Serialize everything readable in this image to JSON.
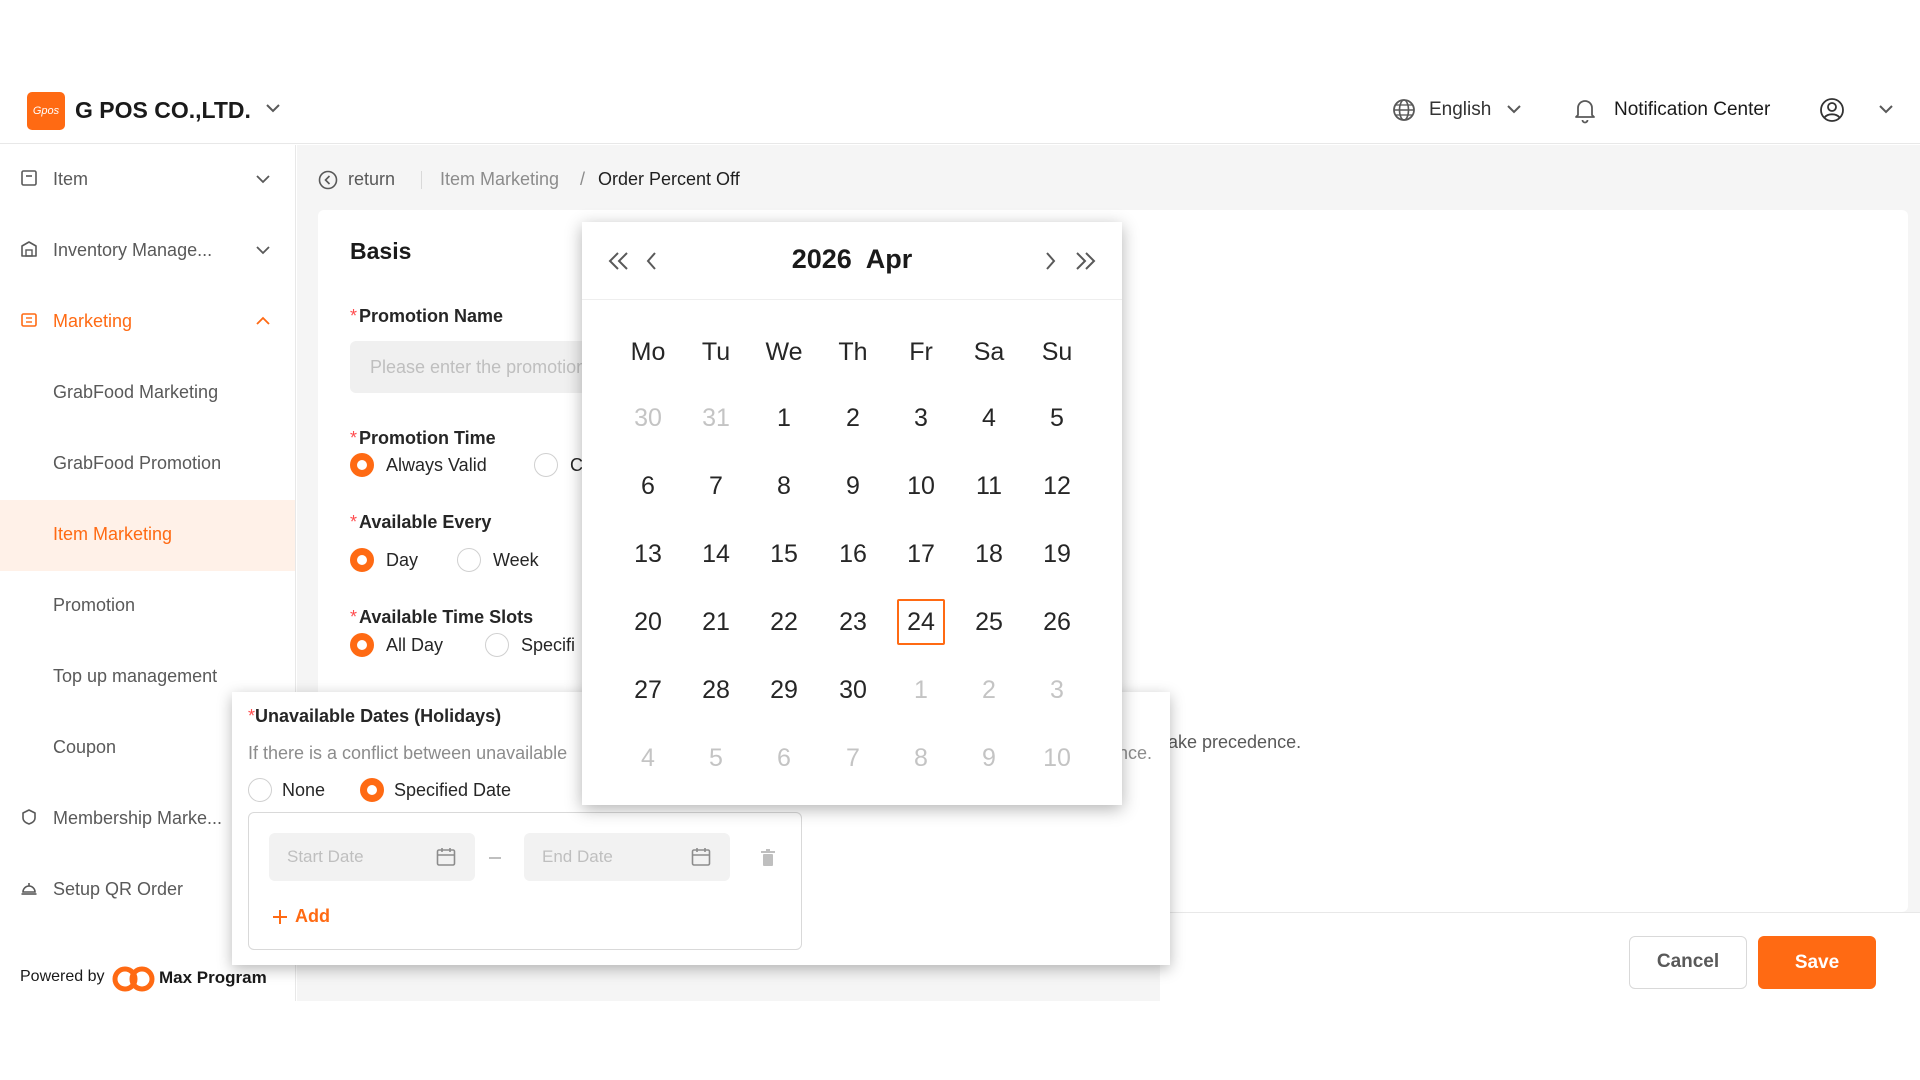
{
  "header": {
    "logo_text": "Gpos",
    "company": "G POS CO.,LTD.",
    "language": "English",
    "notification": "Notification Center"
  },
  "sidebar": {
    "items": [
      {
        "label": "Item",
        "icon": "box-icon"
      },
      {
        "label": "Inventory Manage...",
        "icon": "warehouse-icon"
      },
      {
        "label": "Marketing",
        "icon": "ticket-icon"
      },
      {
        "label": "GrabFood Marketing"
      },
      {
        "label": "GrabFood Promotion"
      },
      {
        "label": "Item Marketing"
      },
      {
        "label": "Promotion"
      },
      {
        "label": "Top up management"
      },
      {
        "label": "Coupon"
      },
      {
        "label": "Membership Marke...",
        "icon": "badge-icon"
      },
      {
        "label": "Setup QR Order",
        "icon": "service-bell-icon"
      }
    ],
    "powered_by": "Powered by",
    "brand": "Max Program"
  },
  "breadcrumb": {
    "return": "return",
    "parent": "Item Marketing",
    "separator": "/",
    "current": "Order Percent Off"
  },
  "form": {
    "section": "Basis",
    "required_mark": "*",
    "promotion_name": {
      "label": "Promotion Name",
      "placeholder": "Please enter the promotion name"
    },
    "promotion_time": {
      "label": "Promotion Time",
      "options": [
        "Always Valid",
        "C"
      ],
      "selected": "Always Valid"
    },
    "available_every": {
      "label": "Available Every",
      "options": [
        "Day",
        "Week"
      ],
      "selected": "Day"
    },
    "time_slots": {
      "label": "Available Time Slots",
      "options": [
        "All Day",
        "Specifi"
      ],
      "selected": "All Day"
    },
    "precedence_note": "ake precedence."
  },
  "holidays": {
    "label": "Unavailable Dates (Holidays)",
    "info": "If there is a conflict between unavailable",
    "info_end": "nce.",
    "options": [
      "None",
      "Specified Date"
    ],
    "selected": "Specified Date",
    "start_placeholder": "Start Date",
    "end_placeholder": "End Date",
    "add": "Add"
  },
  "calendar": {
    "year": "2026",
    "month": "Apr",
    "weekdays": [
      "Mo",
      "Tu",
      "We",
      "Th",
      "Fr",
      "Sa",
      "Su"
    ],
    "weeks": [
      [
        {
          "d": "30",
          "m": true
        },
        {
          "d": "31",
          "m": true
        },
        {
          "d": "1"
        },
        {
          "d": "2"
        },
        {
          "d": "3"
        },
        {
          "d": "4"
        },
        {
          "d": "5"
        }
      ],
      [
        {
          "d": "6"
        },
        {
          "d": "7"
        },
        {
          "d": "8"
        },
        {
          "d": "9"
        },
        {
          "d": "10"
        },
        {
          "d": "11"
        },
        {
          "d": "12"
        }
      ],
      [
        {
          "d": "13"
        },
        {
          "d": "14"
        },
        {
          "d": "15"
        },
        {
          "d": "16"
        },
        {
          "d": "17"
        },
        {
          "d": "18"
        },
        {
          "d": "19"
        }
      ],
      [
        {
          "d": "20"
        },
        {
          "d": "21"
        },
        {
          "d": "22"
        },
        {
          "d": "23"
        },
        {
          "d": "24",
          "today": true
        },
        {
          "d": "25"
        },
        {
          "d": "26"
        }
      ],
      [
        {
          "d": "27"
        },
        {
          "d": "28"
        },
        {
          "d": "29"
        },
        {
          "d": "30"
        },
        {
          "d": "1",
          "m": true
        },
        {
          "d": "2",
          "m": true
        },
        {
          "d": "3",
          "m": true
        }
      ],
      [
        {
          "d": "4",
          "m": true
        },
        {
          "d": "5",
          "m": true
        },
        {
          "d": "6",
          "m": true
        },
        {
          "d": "7",
          "m": true
        },
        {
          "d": "8",
          "m": true
        },
        {
          "d": "9",
          "m": true
        },
        {
          "d": "10",
          "m": true
        }
      ]
    ]
  },
  "actions": {
    "cancel": "Cancel",
    "save": "Save"
  },
  "colors": {
    "accent": "#ff6a13",
    "selected_bg": "#fff1e8",
    "required": "#ff4d4f"
  }
}
